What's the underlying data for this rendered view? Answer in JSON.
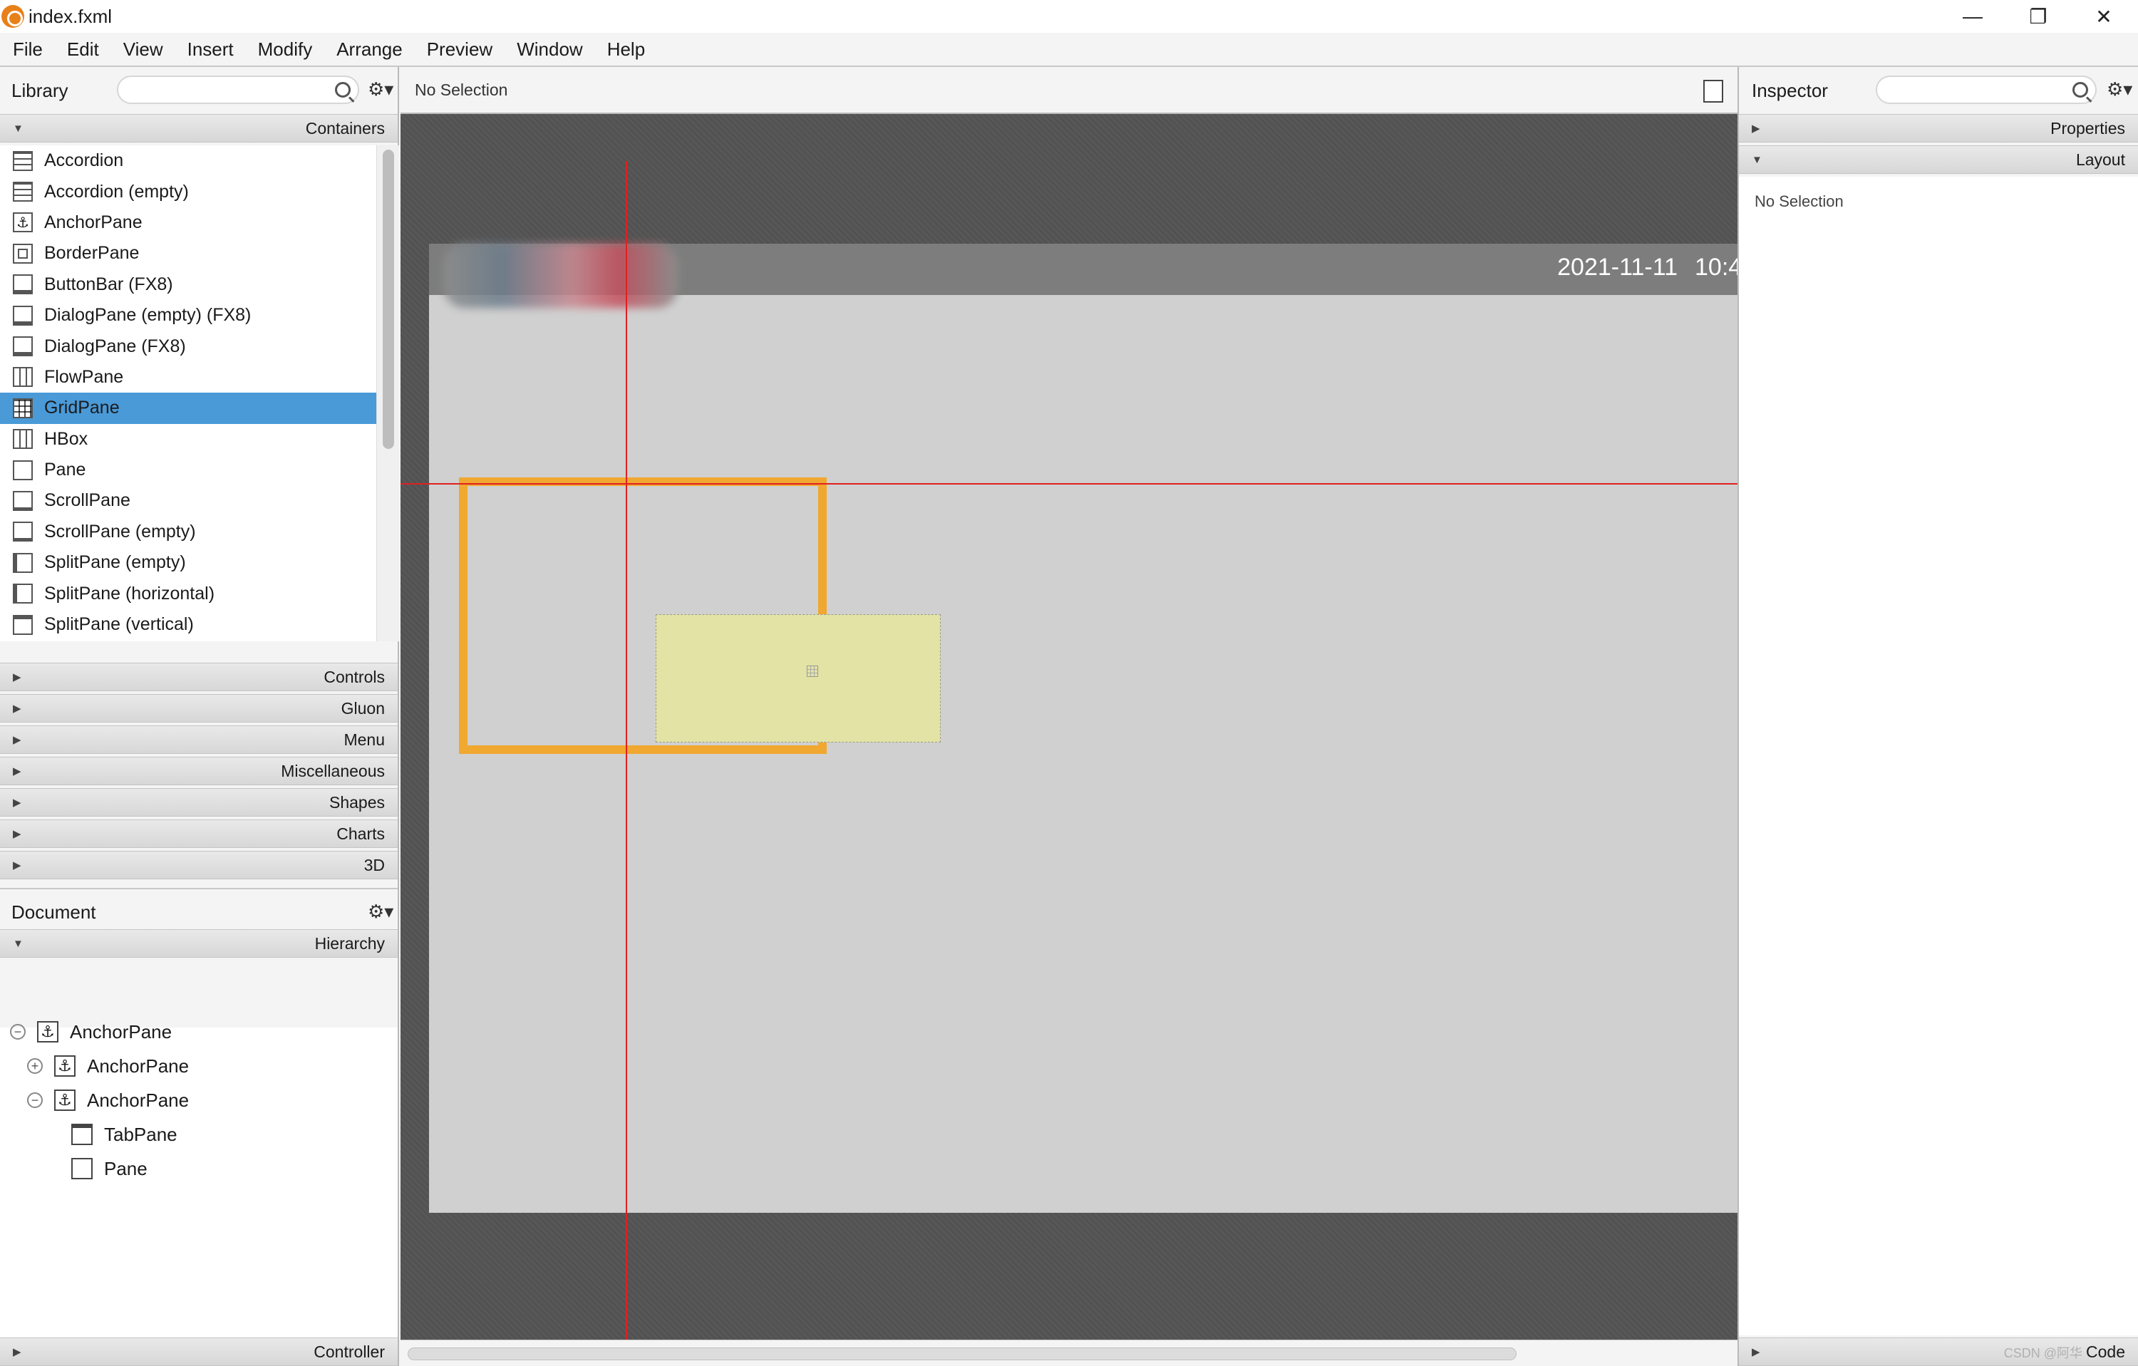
{
  "window": {
    "title": "index.fxml",
    "minimize_icon": "minimize-icon",
    "maximize_icon": "restore-icon",
    "close_icon": "close-icon"
  },
  "menu": [
    "File",
    "Edit",
    "View",
    "Insert",
    "Modify",
    "Arrange",
    "Preview",
    "Window",
    "Help"
  ],
  "library": {
    "title": "Library",
    "search_placeholder": "",
    "containers_label": "Containers",
    "containers": [
      {
        "label": "Accordion",
        "icon": "accordion-icon"
      },
      {
        "label": "Accordion  (empty)",
        "icon": "accordion-icon"
      },
      {
        "label": "AnchorPane",
        "icon": "anchor-icon"
      },
      {
        "label": "BorderPane",
        "icon": "borderpane-icon"
      },
      {
        "label": "ButtonBar  (FX8)",
        "icon": "buttonbar-icon"
      },
      {
        "label": "DialogPane (empty)  (FX8)",
        "icon": "dialogpane-icon"
      },
      {
        "label": "DialogPane  (FX8)",
        "icon": "dialogpane-icon"
      },
      {
        "label": "FlowPane",
        "icon": "flowpane-icon"
      },
      {
        "label": "GridPane",
        "icon": "gridpane-icon"
      },
      {
        "label": "HBox",
        "icon": "hbox-icon"
      },
      {
        "label": "Pane",
        "icon": "pane-icon"
      },
      {
        "label": "ScrollPane",
        "icon": "scrollpane-icon"
      },
      {
        "label": "ScrollPane  (empty)",
        "icon": "scrollpane-icon"
      },
      {
        "label": "SplitPane  (empty)",
        "icon": "splitpane-icon"
      },
      {
        "label": "SplitPane  (horizontal)",
        "icon": "splitpane-icon"
      },
      {
        "label": "SplitPane  (vertical)",
        "icon": "splitpane-icon"
      }
    ],
    "selected": "GridPane",
    "sections": [
      "Controls",
      "Gluon",
      "Menu",
      "Miscellaneous",
      "Shapes",
      "Charts",
      "3D"
    ]
  },
  "document": {
    "title": "Document",
    "hierarchy_label": "Hierarchy",
    "tree": [
      {
        "label": "AnchorPane",
        "toggle": "−",
        "icon": "anchor-icon"
      },
      {
        "label": "AnchorPane",
        "toggle": "+",
        "icon": "anchor-icon"
      },
      {
        "label": "AnchorPane",
        "toggle": "−",
        "icon": "anchor-icon"
      },
      {
        "label": "TabPane",
        "toggle": "",
        "icon": "tabpane-icon"
      },
      {
        "label": "Pane",
        "toggle": "",
        "icon": "pane-icon"
      }
    ],
    "controller_label": "Controller"
  },
  "canvas": {
    "status": "No Selection",
    "app_date": "2021-11-11",
    "app_time": "10:4"
  },
  "inspector": {
    "title": "Inspector",
    "search_placeholder": "",
    "properties_label": "Properties",
    "layout_label": "Layout",
    "empty_text": "No Selection",
    "code_label": "Code"
  },
  "watermark": "CSDN @阿华"
}
